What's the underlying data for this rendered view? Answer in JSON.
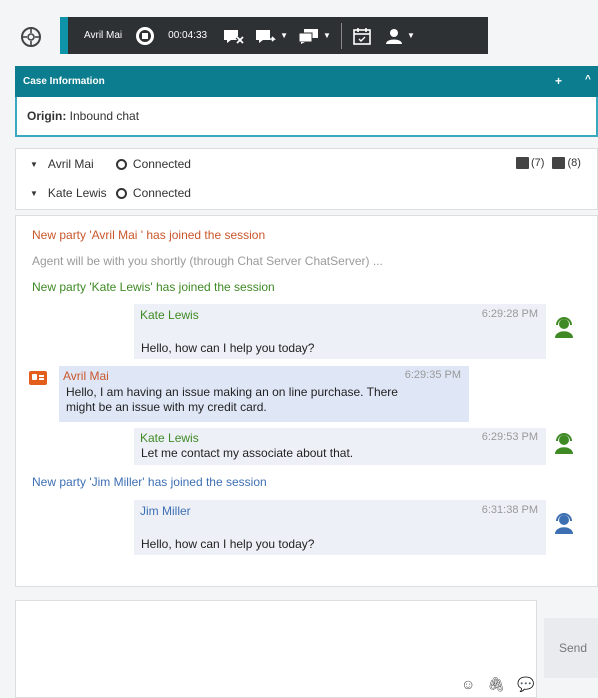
{
  "toolbar": {
    "contact_name": "Avril Mai",
    "timer": "00:04:33"
  },
  "case": {
    "title": "Case Information",
    "plus": "+",
    "collapse": "^",
    "origin_label": "Origin:",
    "origin_value": "Inbound chat"
  },
  "parties": [
    {
      "name": "Avril Mai",
      "status": "Connected"
    },
    {
      "name": "Kate Lewis",
      "status": "Connected"
    }
  ],
  "party_tools": {
    "cases_count": "(7)",
    "history_count": "(8)"
  },
  "transcript": {
    "events": [
      {
        "text": "New party 'Avril Mai ' has joined the session",
        "color": "#c9562a"
      },
      {
        "text": "Agent will be with you shortly (through Chat Server ChatServer) ...",
        "color": "#9a9a9a"
      },
      {
        "text": "New party 'Kate Lewis' has joined the session",
        "color": "#3f8a25"
      },
      {
        "text": "New party 'Jim Miller' has joined the session",
        "color": "#3d6fb3"
      }
    ],
    "messages": [
      {
        "author": "Kate Lewis",
        "time": "6:29:28 PM",
        "lines": [
          "Hello, how can I help you today?"
        ],
        "author_color": "#3f8a25"
      },
      {
        "author": "Avril Mai",
        "time": "6:29:35 PM",
        "lines": [
          "Hello, I am having an issue making an on line purchase. There",
          "might be an issue with my credit card."
        ],
        "author_color": "#c9562a"
      },
      {
        "author": "Kate Lewis",
        "time": "6:29:53 PM",
        "lines": [
          "Let me contact my associate about that."
        ],
        "author_color": "#3f8a25"
      },
      {
        "author": "Jim Miller",
        "time": "6:31:38 PM",
        "lines": [
          "Hello, how can I help you today?"
        ],
        "author_color": "#3d6fb3"
      }
    ]
  },
  "composer": {
    "send_label": "Send"
  },
  "colors": {
    "accent": "#0b7d8f",
    "toolbar_bg": "#2d3134",
    "agent_green": "#3f8a25",
    "agent_blue": "#3d6fb3",
    "client_orange": "#c9562a"
  }
}
